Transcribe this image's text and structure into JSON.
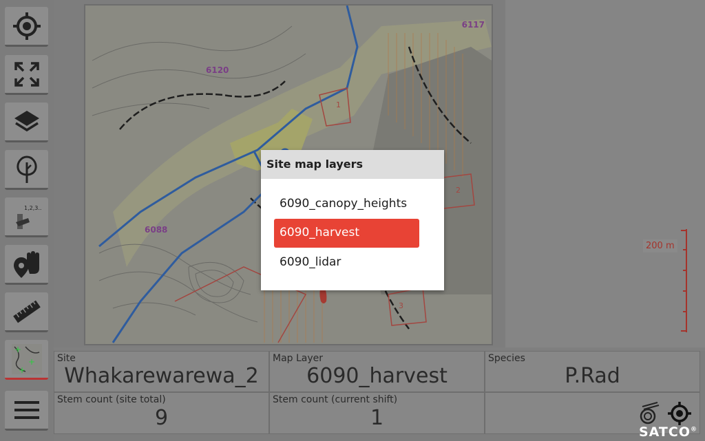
{
  "toolbar": {
    "icons": [
      "locate-icon",
      "fullscreen-icon",
      "layers-icon",
      "tree-icon",
      "stem-count-icon",
      "tag-pin-icon",
      "ruler-icon",
      "tracks-icon",
      "menu-icon"
    ]
  },
  "map": {
    "block_labels": [
      "6117",
      "6120",
      "6088"
    ],
    "harvest_labels": [
      "1",
      "2",
      "3"
    ],
    "scale_label": "200 m"
  },
  "dialog": {
    "title": "Site map layers",
    "layers": [
      "6090_canopy_heights",
      "6090_harvest",
      "6090_lidar"
    ],
    "selected": "6090_harvest"
  },
  "info": {
    "site_label": "Site",
    "site_value": "Whakarewarewa_2",
    "map_layer_label": "Map Layer",
    "map_layer_value": "6090_harvest",
    "species_label": "Species",
    "species_value": "P.Rad",
    "stem_site_label": "Stem count (site total)",
    "stem_site_value": "9",
    "stem_shift_label": "Stem count (current shift)",
    "stem_shift_value": "1"
  },
  "brand": {
    "name": "SATCO",
    "mark": "®"
  },
  "colors": {
    "accent": "#e84335",
    "overlay": "#7f7f7f"
  }
}
